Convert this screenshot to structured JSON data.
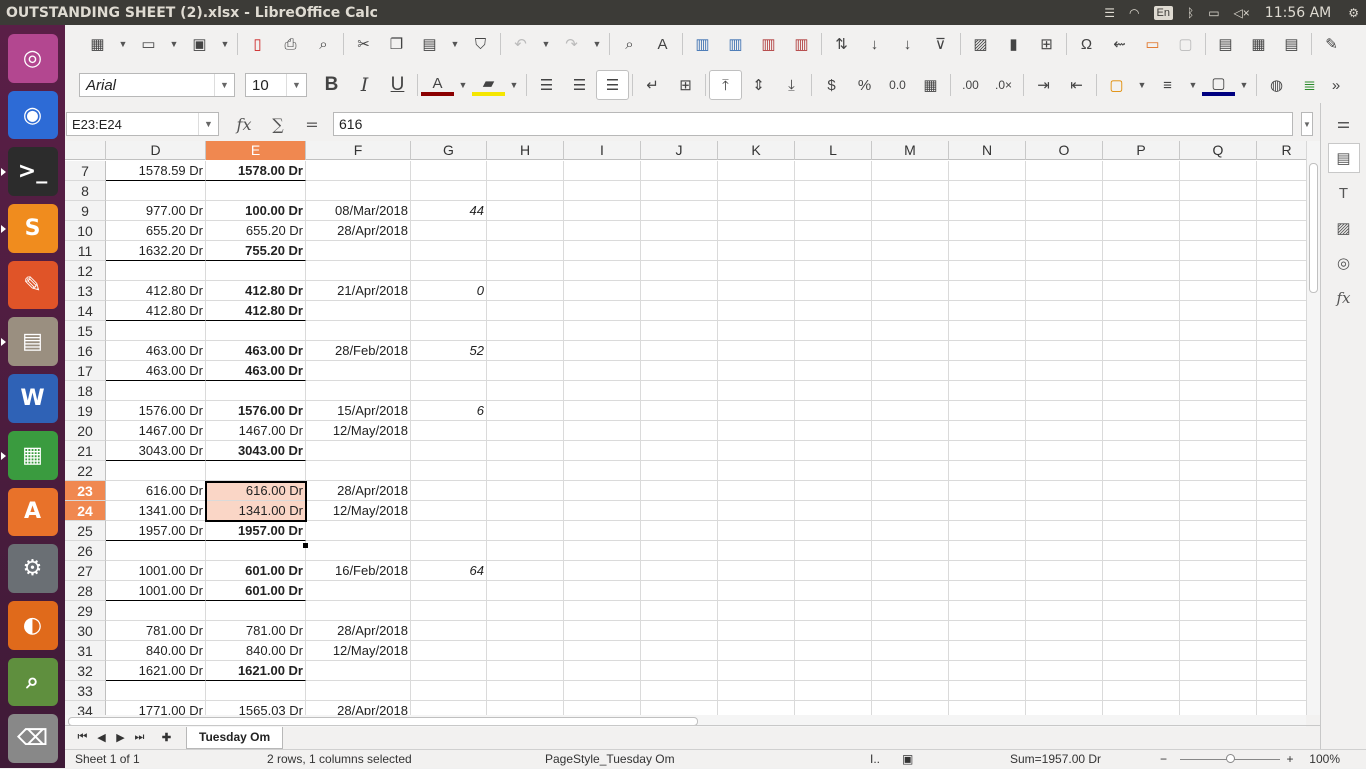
{
  "window": {
    "title": "OUTSTANDING  SHEET (2).xlsx - LibreOffice Calc"
  },
  "panel": {
    "lang": "En",
    "clock": "11:56 AM"
  },
  "launcher": [
    {
      "name": "ubuntu-dash-icon",
      "glyph": "◎",
      "bg": "#b34790",
      "active": false
    },
    {
      "name": "chrome-icon",
      "glyph": "◉",
      "bg": "#2d6bd6",
      "active": false
    },
    {
      "name": "terminal-icon",
      "glyph": ">_",
      "bg": "#2c2c2c",
      "active": true
    },
    {
      "name": "sublime-text-icon",
      "glyph": "S",
      "bg": "#f08c1e",
      "active": true
    },
    {
      "name": "gedit-icon",
      "glyph": "✎",
      "bg": "#e05428",
      "active": false
    },
    {
      "name": "file-manager-icon",
      "glyph": "▤",
      "bg": "#9a8f80",
      "active": true
    },
    {
      "name": "writer-icon",
      "glyph": "W",
      "bg": "#2f62b6",
      "active": false
    },
    {
      "name": "calc-icon",
      "glyph": "▦",
      "bg": "#3a9b3f",
      "active": true
    },
    {
      "name": "software-center-icon",
      "glyph": "A",
      "bg": "#e8722a",
      "active": false
    },
    {
      "name": "settings-icon",
      "glyph": "⚙",
      "bg": "#6a6f74",
      "active": false
    },
    {
      "name": "firefox-icon",
      "glyph": "◐",
      "bg": "#e06a1b",
      "active": false
    },
    {
      "name": "image-viewer-icon",
      "glyph": "⌕",
      "bg": "#5f8f3e",
      "active": false
    },
    {
      "name": "trash-icon",
      "glyph": "⌫",
      "bg": "#888",
      "active": false
    }
  ],
  "font": {
    "name": "Arial",
    "size": "10"
  },
  "namebox": "E23:E24",
  "formula": "616",
  "columns": [
    {
      "label": "D",
      "sel": false
    },
    {
      "label": "E",
      "sel": true
    },
    {
      "label": "F",
      "sel": false
    },
    {
      "label": "G",
      "sel": false
    },
    {
      "label": "H",
      "sel": false
    },
    {
      "label": "I",
      "sel": false
    },
    {
      "label": "J",
      "sel": false
    },
    {
      "label": "K",
      "sel": false
    },
    {
      "label": "L",
      "sel": false
    },
    {
      "label": "M",
      "sel": false
    },
    {
      "label": "N",
      "sel": false
    },
    {
      "label": "O",
      "sel": false
    },
    {
      "label": "P",
      "sel": false
    },
    {
      "label": "Q",
      "sel": false
    },
    {
      "label": "R",
      "sel": false
    }
  ],
  "rows": [
    {
      "n": "7",
      "d": "1578.59 Dr",
      "e": "1578.00 Dr",
      "eb": true,
      "f": "",
      "g": "",
      "bd": true
    },
    {
      "n": "8",
      "d": "",
      "e": "",
      "eb": false,
      "f": "",
      "g": "",
      "bd": false
    },
    {
      "n": "9",
      "d": "977.00 Dr",
      "e": "100.00 Dr",
      "eb": true,
      "f": "08/Mar/2018",
      "g": "44",
      "bd": false
    },
    {
      "n": "10",
      "d": "655.20 Dr",
      "e": "655.20 Dr",
      "eb": false,
      "f": "28/Apr/2018",
      "g": "",
      "bd": false
    },
    {
      "n": "11",
      "d": "1632.20 Dr",
      "e": "755.20 Dr",
      "eb": true,
      "f": "",
      "g": "",
      "bd": true
    },
    {
      "n": "12",
      "d": "",
      "e": "",
      "eb": false,
      "f": "",
      "g": "",
      "bd": false
    },
    {
      "n": "13",
      "d": "412.80 Dr",
      "e": "412.80 Dr",
      "eb": true,
      "f": "21/Apr/2018",
      "g": "0",
      "bd": false
    },
    {
      "n": "14",
      "d": "412.80 Dr",
      "e": "412.80 Dr",
      "eb": true,
      "f": "",
      "g": "",
      "bd": true
    },
    {
      "n": "15",
      "d": "",
      "e": "",
      "eb": false,
      "f": "",
      "g": "",
      "bd": false
    },
    {
      "n": "16",
      "d": "463.00 Dr",
      "e": "463.00 Dr",
      "eb": true,
      "f": "28/Feb/2018",
      "g": "52",
      "bd": false
    },
    {
      "n": "17",
      "d": "463.00 Dr",
      "e": "463.00 Dr",
      "eb": true,
      "f": "",
      "g": "",
      "bd": true
    },
    {
      "n": "18",
      "d": "",
      "e": "",
      "eb": false,
      "f": "",
      "g": "",
      "bd": false
    },
    {
      "n": "19",
      "d": "1576.00 Dr",
      "e": "1576.00 Dr",
      "eb": true,
      "f": "15/Apr/2018",
      "g": "6",
      "bd": false
    },
    {
      "n": "20",
      "d": "1467.00 Dr",
      "e": "1467.00 Dr",
      "eb": false,
      "f": "12/May/2018",
      "g": "",
      "bd": false
    },
    {
      "n": "21",
      "d": "3043.00 Dr",
      "e": "3043.00 Dr",
      "eb": true,
      "f": "",
      "g": "",
      "bd": true
    },
    {
      "n": "22",
      "d": "",
      "e": "",
      "eb": false,
      "f": "",
      "g": "",
      "bd": false
    },
    {
      "n": "23",
      "d": "616.00 Dr",
      "e": "616.00 Dr",
      "eb": false,
      "f": "28/Apr/2018",
      "g": "",
      "bd": false,
      "sel": true
    },
    {
      "n": "24",
      "d": "1341.00 Dr",
      "e": "1341.00 Dr",
      "eb": false,
      "f": "12/May/2018",
      "g": "",
      "bd": false,
      "sel": true
    },
    {
      "n": "25",
      "d": "1957.00 Dr",
      "e": "1957.00 Dr",
      "eb": true,
      "f": "",
      "g": "",
      "bd": true
    },
    {
      "n": "26",
      "d": "",
      "e": "",
      "eb": false,
      "f": "",
      "g": "",
      "bd": false
    },
    {
      "n": "27",
      "d": "1001.00 Dr",
      "e": "601.00 Dr",
      "eb": true,
      "f": "16/Feb/2018",
      "g": "64",
      "bd": false
    },
    {
      "n": "28",
      "d": "1001.00 Dr",
      "e": "601.00 Dr",
      "eb": true,
      "f": "",
      "g": "",
      "bd": true
    },
    {
      "n": "29",
      "d": "",
      "e": "",
      "eb": false,
      "f": "",
      "g": "",
      "bd": false
    },
    {
      "n": "30",
      "d": "781.00 Dr",
      "e": "781.00 Dr",
      "eb": false,
      "f": "28/Apr/2018",
      "g": "",
      "bd": false
    },
    {
      "n": "31",
      "d": "840.00 Dr",
      "e": "840.00 Dr",
      "eb": false,
      "f": "12/May/2018",
      "g": "",
      "bd": false
    },
    {
      "n": "32",
      "d": "1621.00 Dr",
      "e": "1621.00 Dr",
      "eb": true,
      "f": "",
      "g": "",
      "bd": true
    },
    {
      "n": "33",
      "d": "",
      "e": "",
      "eb": false,
      "f": "",
      "g": "",
      "bd": false
    },
    {
      "n": "34",
      "d": "1771.00 Dr",
      "e": "1565.03 Dr",
      "eb": false,
      "f": "28/Apr/2018",
      "g": "",
      "bd": false
    }
  ],
  "sheet_tab": "Tuesday Om",
  "status": {
    "sheet": "Sheet 1 of 1",
    "selection": "2 rows, 1 columns selected",
    "pagestyle": "PageStyle_Tuesday Om",
    "sum": "Sum=1957.00 Dr",
    "zoom": "100%"
  }
}
